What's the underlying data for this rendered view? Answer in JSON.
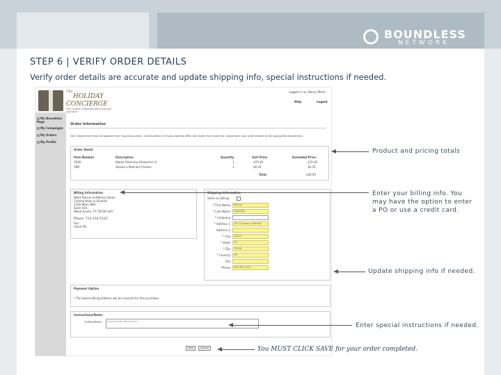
{
  "brand": {
    "line1": "BOUNDLESS",
    "line2": "NETWORK"
  },
  "slide": {
    "title": "STEP 6 | VERIFY ORDER DETAILS",
    "subtitle": "Verify order details are accurate and update shipping info, special instructions if needed."
  },
  "app": {
    "logo": {
      "small": "The",
      "big1": "HOLIDAY",
      "big2": "CONCIERGE",
      "tag": "Your custom corporate gift giving gift specialist"
    },
    "logged_in": "Logged in as: Nancy Meier",
    "help": "Help",
    "logout": "Logout",
    "sidebar": [
      "My Boundless Page",
      "My Campaigns",
      "My Orders",
      "My Profile"
    ],
    "page_heading": "Order Information",
    "notice": "Each department head will approve their respecting orders. Communities in Schools expense office will handle the invoice but charge back each order amount to the appropriate department.",
    "order_detail": {
      "title": "Order Detail",
      "headers": [
        "Item Number",
        "Description",
        "Quantity",
        "Unit Price",
        "Extended Price"
      ],
      "rows": [
        [
          "1836",
          "Waldo Fietenhas Deliverers In",
          "1",
          "$70.40",
          "$70.40"
        ],
        [
          "TBD",
          "Stooeo a Matches Cheese",
          "1",
          "$6.35",
          "$6.35"
        ]
      ],
      "total_label": "Total",
      "total_value": "$36.95"
    },
    "billing": {
      "title": "Billing Information",
      "lines": [
        "Ward Pierner & Melissa Simon",
        "Communities in Schools",
        "2316 West 38th",
        "Suite 160",
        "Wood Austin, TX 78746 USA"
      ],
      "phone": "Phone: 713-554-1515",
      "fax": "Fax:",
      "payment": "Client PO"
    },
    "shipping": {
      "title": "Shipping Information",
      "same_as_billing": "Same as billing:",
      "fields": [
        {
          "label": "* First Name:",
          "value": "Marion"
        },
        {
          "label": "* Last Name:",
          "value": "Papbelter"
        },
        {
          "label": "* Company:",
          "value": ""
        },
        {
          "label": "* Address 1:",
          "value": "101 Company Address"
        },
        {
          "label": "Address 2:",
          "value": ""
        },
        {
          "label": "* City:",
          "value": "Austin"
        },
        {
          "label": "* State:",
          "value": "TX"
        },
        {
          "label": "* Zip:",
          "value": "78746"
        },
        {
          "label": "* Country:",
          "value": "US"
        },
        {
          "label": "Fax:",
          "value": ""
        },
        {
          "label": "Phone:",
          "value": "555-555-1222"
        }
      ]
    },
    "payment_option": {
      "title": "Payment Option",
      "text": "* The above billing address will be invoiced for this purchase."
    },
    "instructions": {
      "title": "Instructions/Notes",
      "label": "Instructions:",
      "placeholder": "Special Instr. Notes Here"
    },
    "save": "Save",
    "cancel": "Cancel"
  },
  "callouts": {
    "totals": "Product and pricing totals",
    "billing": "Enter your billing info. You may have the option to enter a PO or use a credit card.",
    "shipping": "Update shipping info if needed.",
    "instructions": "Enter special instructions if needed.",
    "save": "You MUST CLICK SAVE for your order completed."
  }
}
